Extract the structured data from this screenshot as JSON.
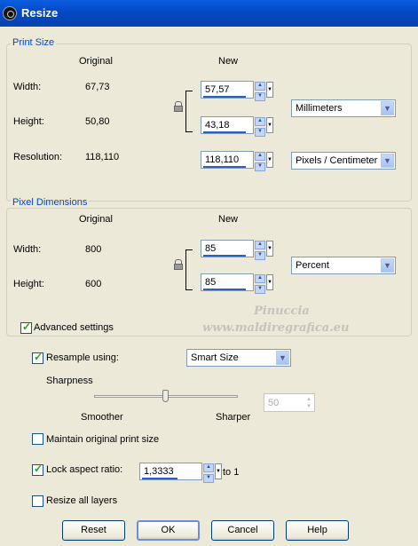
{
  "window": {
    "title": "Resize"
  },
  "print_size": {
    "legend": "Print Size",
    "original_header": "Original",
    "new_header": "New",
    "width_label": "Width:",
    "width_original": "67,73",
    "height_label": "Height:",
    "height_original": "50,80",
    "resolution_label": "Resolution:",
    "resolution_original": "118,110",
    "width_new": "57,57",
    "height_new": "43,18",
    "resolution_new": "118,110",
    "units": "Millimeters",
    "resolution_units": "Pixels / Centimeter"
  },
  "pixel_dimensions": {
    "legend": "Pixel Dimensions",
    "original_header": "Original",
    "new_header": "New",
    "width_label": "Width:",
    "width_original": "800",
    "height_label": "Height:",
    "height_original": "600",
    "width_new": "85",
    "height_new": "85",
    "units": "Percent"
  },
  "watermark": {
    "line1": "Pinuccia",
    "line2": "www.maldiregrafica.eu"
  },
  "advanced": {
    "label": "Advanced settings",
    "checked": true
  },
  "resample": {
    "label": "Resample using:",
    "checked": true,
    "method": "Smart Size"
  },
  "sharpness": {
    "label": "Sharpness",
    "min_label": "Smoother",
    "max_label": "Sharper",
    "value": "50",
    "level": 0.5
  },
  "maintain": {
    "label": "Maintain original print size",
    "checked": false
  },
  "lock": {
    "label": "Lock aspect ratio:",
    "checked": true,
    "value": "1,3333",
    "suffix": "to 1"
  },
  "layers": {
    "label": "Resize all layers",
    "checked": false
  },
  "buttons": {
    "reset": "Reset",
    "ok": "OK",
    "cancel": "Cancel",
    "help": "Help"
  }
}
